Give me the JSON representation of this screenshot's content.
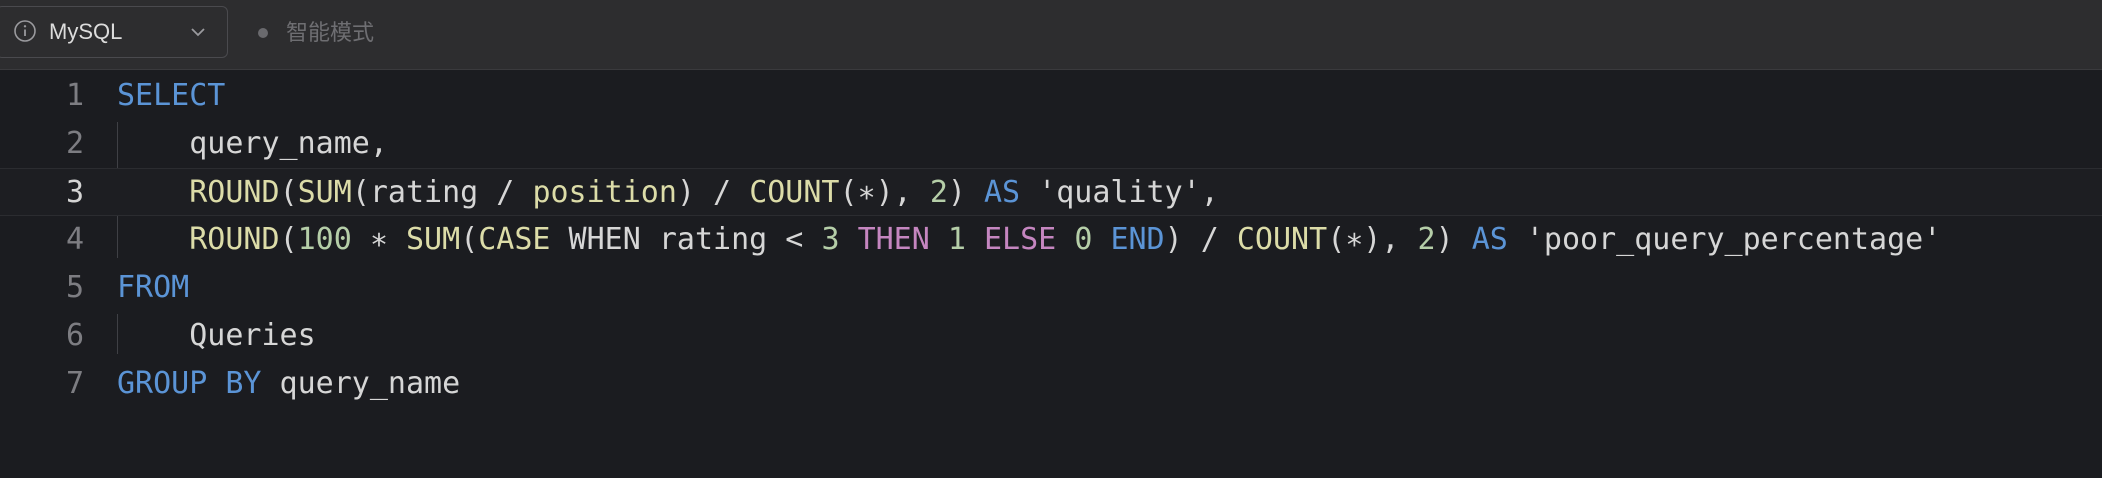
{
  "toolbar": {
    "language": "MySQL",
    "mode_label": "智能模式"
  },
  "icons": {
    "info": "info-circle-icon",
    "chevron": "chevron-down-icon"
  },
  "editor": {
    "active_line": 3,
    "lines": [
      {
        "number": "1",
        "tokens": [
          {
            "t": "SELECT",
            "c": "kw"
          }
        ]
      },
      {
        "number": "2",
        "tokens": [
          {
            "t": "    query_name,",
            "c": "id"
          }
        ]
      },
      {
        "number": "3",
        "tokens": [
          {
            "t": "    ",
            "c": "id"
          },
          {
            "t": "ROUND",
            "c": "fn"
          },
          {
            "t": "(",
            "c": "op"
          },
          {
            "t": "SUM",
            "c": "fn"
          },
          {
            "t": "(rating / ",
            "c": "id"
          },
          {
            "t": "position",
            "c": "fn"
          },
          {
            "t": ") / ",
            "c": "op"
          },
          {
            "t": "COUNT",
            "c": "fn"
          },
          {
            "t": "(∗), ",
            "c": "op"
          },
          {
            "t": "2",
            "c": "num"
          },
          {
            "t": ") ",
            "c": "op"
          },
          {
            "t": "AS",
            "c": "kw"
          },
          {
            "t": " 'quality',",
            "c": "str"
          }
        ]
      },
      {
        "number": "4",
        "tokens": [
          {
            "t": "    ",
            "c": "id"
          },
          {
            "t": "ROUND",
            "c": "fn"
          },
          {
            "t": "(",
            "c": "op"
          },
          {
            "t": "100",
            "c": "num"
          },
          {
            "t": " ∗ ",
            "c": "op"
          },
          {
            "t": "SUM",
            "c": "fn"
          },
          {
            "t": "(",
            "c": "op"
          },
          {
            "t": "CASE",
            "c": "fn"
          },
          {
            "t": " WHEN rating < ",
            "c": "id"
          },
          {
            "t": "3",
            "c": "num"
          },
          {
            "t": " ",
            "c": "id"
          },
          {
            "t": "THEN",
            "c": "ctl"
          },
          {
            "t": " ",
            "c": "id"
          },
          {
            "t": "1",
            "c": "num"
          },
          {
            "t": " ",
            "c": "id"
          },
          {
            "t": "ELSE",
            "c": "ctl"
          },
          {
            "t": " ",
            "c": "id"
          },
          {
            "t": "0",
            "c": "num"
          },
          {
            "t": " ",
            "c": "id"
          },
          {
            "t": "END",
            "c": "kw"
          },
          {
            "t": ") / ",
            "c": "op"
          },
          {
            "t": "COUNT",
            "c": "fn"
          },
          {
            "t": "(∗), ",
            "c": "op"
          },
          {
            "t": "2",
            "c": "num"
          },
          {
            "t": ") ",
            "c": "op"
          },
          {
            "t": "AS",
            "c": "kw"
          },
          {
            "t": " 'poor_query_percentage'",
            "c": "str"
          }
        ]
      },
      {
        "number": "5",
        "tokens": [
          {
            "t": "FROM",
            "c": "kw"
          }
        ]
      },
      {
        "number": "6",
        "tokens": [
          {
            "t": "    Queries",
            "c": "id"
          }
        ]
      },
      {
        "number": "7",
        "tokens": [
          {
            "t": "GROUP BY",
            "c": "kw"
          },
          {
            "t": " query_name",
            "c": "id"
          }
        ]
      }
    ]
  }
}
